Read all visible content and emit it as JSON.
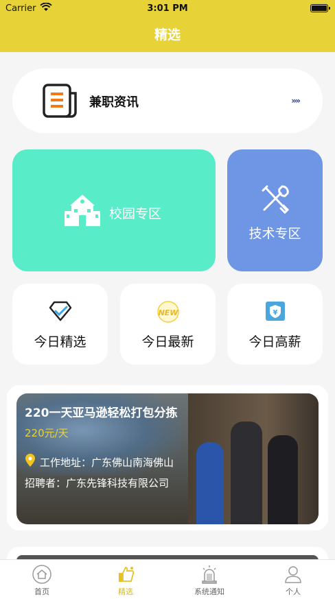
{
  "status_bar": {
    "carrier": "Carrier",
    "time": "3:01 PM"
  },
  "header": {
    "title": "精选"
  },
  "news": {
    "label": "兼职资讯",
    "arrows": "››››"
  },
  "zones": {
    "campus": "校园专区",
    "tech": "技术专区"
  },
  "shortcuts": [
    {
      "label": "今日精选",
      "icon": "diamond-icon"
    },
    {
      "label": "今日最新",
      "icon": "new-badge-icon"
    },
    {
      "label": "今日高薪",
      "icon": "yuan-shield-icon"
    }
  ],
  "job": {
    "title": "220一天亚马逊轻松打包分拣",
    "salary": "220元/天",
    "address": "工作地址：广东佛山南海佛山",
    "company": "招聘者：广东先锋科技有限公司"
  },
  "tabs": [
    {
      "label": "首页",
      "icon": "home-icon"
    },
    {
      "label": "精选",
      "icon": "thumbs-up-icon",
      "active": true
    },
    {
      "label": "系统通知",
      "icon": "alarm-icon"
    },
    {
      "label": "个人",
      "icon": "user-icon"
    }
  ],
  "colors": {
    "accent": "#e7d337",
    "campus": "#58ecc8",
    "tech": "#6e96e4",
    "salary": "#e8d23a"
  }
}
